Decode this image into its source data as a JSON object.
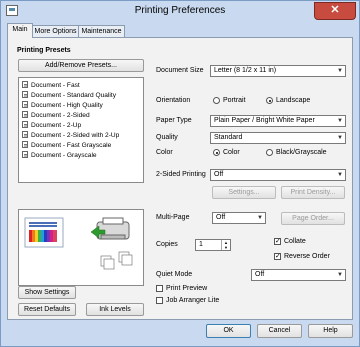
{
  "window": {
    "title": "Printing Preferences",
    "close_glyph": "✕"
  },
  "tabs": [
    "Main",
    "More Options",
    "Maintenance"
  ],
  "presets": {
    "heading": "Printing Presets",
    "add_button": "Add/Remove Presets...",
    "items": [
      "Document - Fast",
      "Document - Standard Quality",
      "Document - High Quality",
      "Document - 2-Sided",
      "Document - 2-Up",
      "Document - 2-Sided with 2-Up",
      "Document - Fast Grayscale",
      "Document - Grayscale"
    ]
  },
  "bottom_left": {
    "show_settings": "Show Settings",
    "reset_defaults": "Reset Defaults",
    "ink_levels": "Ink Levels"
  },
  "settings": {
    "document_size_label": "Document Size",
    "document_size_value": "Letter (8 1/2 x 11 in)",
    "orientation_label": "Orientation",
    "portrait": "Portrait",
    "landscape": "Landscape",
    "paper_type_label": "Paper Type",
    "paper_type_value": "Plain Paper / Bright White Paper",
    "quality_label": "Quality",
    "quality_value": "Standard",
    "color_label": "Color",
    "color_option": "Color",
    "bw_option": "Black/Grayscale",
    "two_sided_label": "2-Sided Printing",
    "two_sided_value": "Off",
    "settings_button": "Settings...",
    "print_density_button": "Print Density...",
    "multipage_label": "Multi-Page",
    "multipage_value": "Off",
    "page_order_button": "Page Order...",
    "copies_label": "Copies",
    "copies_value": "1",
    "collate": "Collate",
    "reverse_order": "Reverse Order",
    "quiet_mode_label": "Quiet Mode",
    "quiet_mode_value": "Off",
    "print_preview": "Print Preview",
    "job_arranger": "Job Arranger Lite"
  },
  "footer": {
    "ok": "OK",
    "cancel": "Cancel",
    "help": "Help"
  },
  "icons": {
    "dropdown": "▼",
    "check": "✓",
    "spin_up": "▲",
    "spin_down": "▼"
  }
}
